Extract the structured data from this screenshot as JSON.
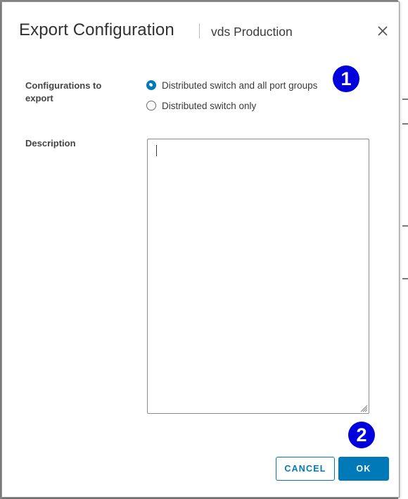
{
  "dialog": {
    "title": "Export Configuration",
    "subtitle": "vds Production",
    "close_icon": "close-icon"
  },
  "form": {
    "configurations_label": "Configurations to export",
    "options": [
      {
        "label": "Distributed switch and all port groups",
        "selected": true
      },
      {
        "label": "Distributed switch only",
        "selected": false
      }
    ],
    "description_label": "Description",
    "description_value": ""
  },
  "callouts": [
    "1",
    "2"
  ],
  "footer": {
    "cancel_label": "CANCEL",
    "ok_label": "OK"
  },
  "colors": {
    "accent": "#0079b8",
    "callout": "#0000dd",
    "title_text": "#313131"
  }
}
